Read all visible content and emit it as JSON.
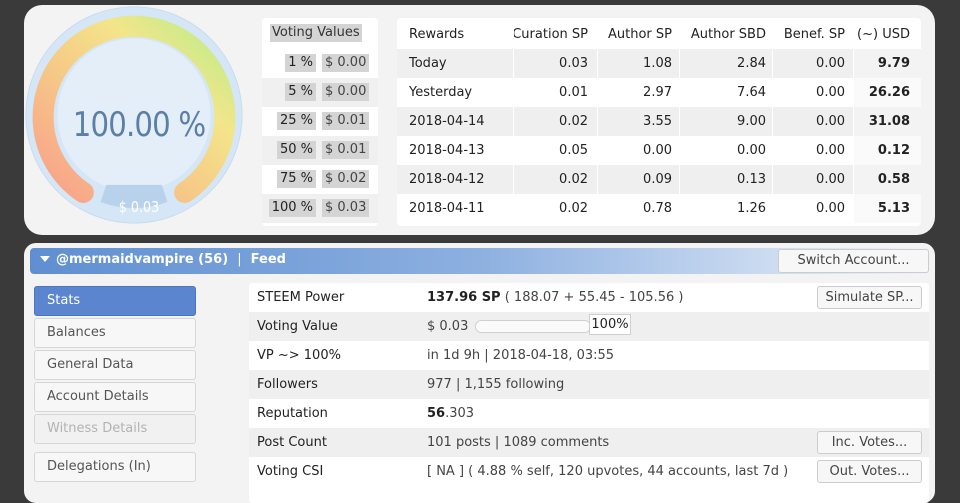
{
  "gauge": {
    "percent_text": "100.00 %",
    "percent": 100,
    "usd": "$ 0.03"
  },
  "voting_values": {
    "header": "Voting Values",
    "rows": [
      {
        "pct": "1 %",
        "usd": "$ 0.00"
      },
      {
        "pct": "5 %",
        "usd": "$ 0.00"
      },
      {
        "pct": "25 %",
        "usd": "$ 0.01"
      },
      {
        "pct": "50 %",
        "usd": "$ 0.01"
      },
      {
        "pct": "75 %",
        "usd": "$ 0.02"
      },
      {
        "pct": "100 %",
        "usd": "$ 0.03"
      }
    ]
  },
  "rewards": {
    "headers": [
      "Rewards",
      "Curation SP",
      "Author SP",
      "Author SBD",
      "Benef. SP",
      "(~) USD"
    ],
    "rows": [
      [
        "Today",
        "0.03",
        "1.08",
        "2.84",
        "0.00",
        "9.79"
      ],
      [
        "Yesterday",
        "0.01",
        "2.97",
        "7.64",
        "0.00",
        "26.26"
      ],
      [
        "2018-04-14",
        "0.02",
        "3.55",
        "9.00",
        "0.00",
        "31.08"
      ],
      [
        "2018-04-13",
        "0.05",
        "0.00",
        "0.00",
        "0.00",
        "0.12"
      ],
      [
        "2018-04-12",
        "0.02",
        "0.09",
        "0.13",
        "0.00",
        "0.58"
      ],
      [
        "2018-04-11",
        "0.02",
        "0.78",
        "1.26",
        "0.00",
        "5.13"
      ]
    ]
  },
  "account_bar": {
    "account": "@mermaidvampire (56)",
    "separator": "|",
    "section": "Feed",
    "switch_label": "Switch Account..."
  },
  "nav": {
    "items": [
      "Stats",
      "Balances",
      "General Data",
      "Account Details",
      "Witness Details",
      "Delegations (In)"
    ]
  },
  "stats": {
    "steem_power": {
      "label": "STEEM Power",
      "value_bold": "137.96 SP",
      "value_rest": " ( 188.07 + 55.45 - 105.56 )",
      "button": "Simulate SP..."
    },
    "voting_value": {
      "label": "Voting Value",
      "value": "$ 0.03",
      "bar_percent": 100,
      "bar_text": "100%"
    },
    "vp": {
      "label": "VP ~> 100%",
      "value": "in 1d 9h | 2018-04-18, 03:55"
    },
    "followers": {
      "label": "Followers",
      "value": "977 | 1,155 following"
    },
    "reputation": {
      "label": "Reputation",
      "value_bold": "56",
      "value_rest": ".303"
    },
    "post_count": {
      "label": "Post Count",
      "value": "101 posts | 1089 comments",
      "button": "Inc. Votes..."
    },
    "voting_csi": {
      "label": "Voting CSI",
      "value": "[ NA ] ( 4.88 % self, 120 upvotes, 44 accounts, last 7d )",
      "button": "Out. Votes..."
    }
  }
}
